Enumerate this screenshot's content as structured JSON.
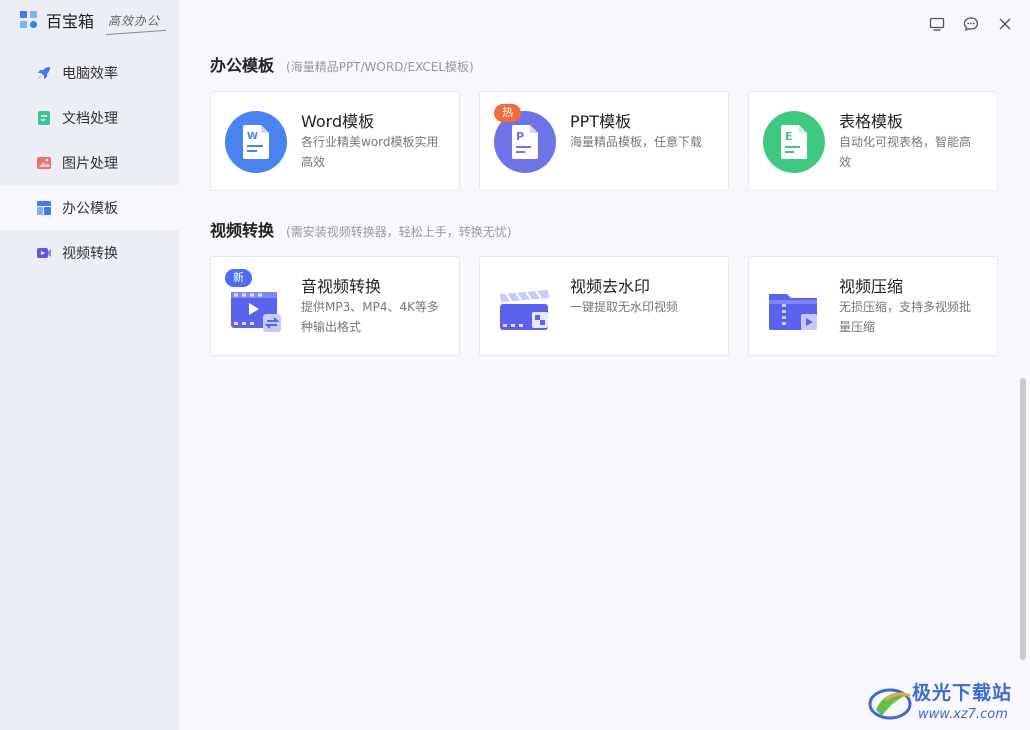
{
  "app": {
    "title": "百宝箱",
    "slogan": "高效办公"
  },
  "sidebar": {
    "items": [
      {
        "label": "电脑效率",
        "icon": "rocket-icon",
        "color": "#3b7cf5"
      },
      {
        "label": "文档处理",
        "icon": "document-icon",
        "color": "#36c98b"
      },
      {
        "label": "图片处理",
        "icon": "image-icon",
        "color": "#f26d6d"
      },
      {
        "label": "办公模板",
        "icon": "template-icon",
        "color": "#3b7cf5",
        "active": true
      },
      {
        "label": "视频转换",
        "icon": "video-icon",
        "color": "#5b57e8"
      }
    ]
  },
  "window_controls": {
    "icons": [
      "monitor-icon",
      "feedback-icon",
      "close-icon"
    ]
  },
  "sections": [
    {
      "title": "办公模板",
      "subtitle": "(海量精品PPT/WORD/EXCEL模板)",
      "cards": [
        {
          "title": "Word模板",
          "desc": "各行业精美word模板实用高效",
          "icon": "word-template-icon",
          "badge": ""
        },
        {
          "title": "PPT模板",
          "desc": "海量精品模板，任意下载",
          "icon": "ppt-template-icon",
          "badge": "热"
        },
        {
          "title": "表格模板",
          "desc": "自动化可视表格，智能高效",
          "icon": "excel-template-icon",
          "badge": ""
        }
      ]
    },
    {
      "title": "视频转换",
      "subtitle": "(需安装视频转换器，轻松上手，转换无忧)",
      "cards": [
        {
          "title": "音视频转换",
          "desc": "提供MP3、MP4、4K等多种输出格式",
          "icon": "video-convert-icon",
          "badge": "新"
        },
        {
          "title": "视频去水印",
          "desc": "一键提取无水印视频",
          "icon": "video-watermark-icon",
          "badge": ""
        },
        {
          "title": "视频压缩",
          "desc": "无损压缩，支持多视频批量压缩",
          "icon": "video-compress-icon",
          "badge": ""
        }
      ]
    }
  ],
  "colors": {
    "accent": "#3b7cf5",
    "badge_hot": "#f26a3d",
    "badge_new": "#4a6cf7",
    "word": "#4a84f0",
    "ppt": "#6c74e8",
    "excel": "#3ec97e"
  },
  "watermark": {
    "text": "极光下载站",
    "url": "www.xz7.com"
  }
}
